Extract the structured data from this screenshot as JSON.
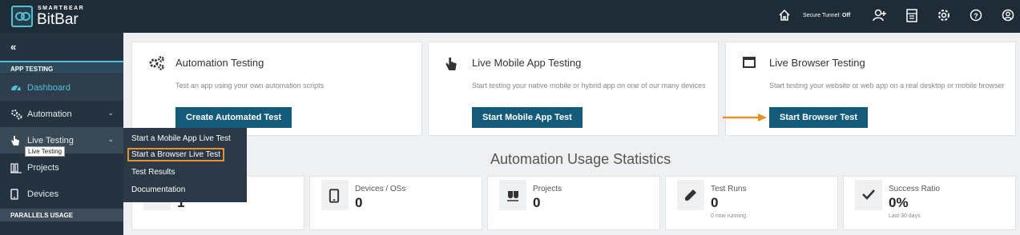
{
  "brand": {
    "small": "SMARTBEAR",
    "big": "BitBar"
  },
  "topbar": {
    "tunnel_label": "Secure Tunnel:",
    "tunnel_state": "Off",
    "icons": [
      "home-icon",
      "add-user-icon",
      "document-icon",
      "gear-icon",
      "help-icon",
      "account-icon"
    ]
  },
  "sidebar": {
    "collapse": "«",
    "section_app_testing": "APP TESTING",
    "section_parallels": "PARALLELS USAGE",
    "items": [
      {
        "label": "Dashboard",
        "icon": "dashboard-icon"
      },
      {
        "label": "Automation",
        "icon": "automation-gears-icon"
      },
      {
        "label": "Live Testing",
        "icon": "hand-pointer-icon"
      },
      {
        "label": "Projects",
        "icon": "projects-icon"
      },
      {
        "label": "Devices",
        "icon": "device-icon"
      }
    ],
    "tooltip": "Live Testing"
  },
  "dropdown": {
    "items": [
      "Start a Mobile App Live Test",
      "Start a Browser Live Test",
      "Test Results",
      "Documentation"
    ]
  },
  "cards": [
    {
      "title": "Automation Testing",
      "desc": "Test an app using your own automation scripts",
      "button": "Create Automated Test",
      "icon": "gears-icon"
    },
    {
      "title": "Live Mobile App Testing",
      "desc": "Start testing your native mobile or hybrid app on one of our many devices",
      "button": "Start Mobile App Test",
      "icon": "hand-pointer-icon"
    },
    {
      "title": "Live Browser Testing",
      "desc": "Start testing your website or web app on a real desktop or mobile browser",
      "button": "Start Browser Test",
      "icon": "browser-window-icon"
    }
  ],
  "stats_title": "Automation Usage Statistics",
  "stats": [
    {
      "label": "",
      "value": "1",
      "sub": ""
    },
    {
      "label": "Devices / OSs",
      "value": "0",
      "sub": ""
    },
    {
      "label": "Projects",
      "value": "0",
      "sub": ""
    },
    {
      "label": "Test Runs",
      "value": "0",
      "sub": "0 now running"
    },
    {
      "label": "Success Ratio",
      "value": "0%",
      "sub": "Last 30 days"
    }
  ],
  "colors": {
    "accent": "#4fc1d8",
    "button": "#135b78",
    "highlight": "#e8912b"
  }
}
